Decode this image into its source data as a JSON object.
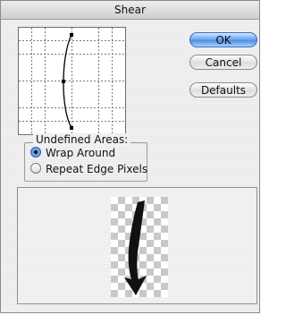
{
  "window": {
    "title": "Shear"
  },
  "buttons": {
    "ok": "OK",
    "cancel": "Cancel",
    "defaults": "Defaults"
  },
  "undefined_areas": {
    "label": "Undefined Areas:",
    "options": [
      {
        "label": "Wrap Around",
        "selected": true
      },
      {
        "label": "Repeat Edge Pixels",
        "selected": false
      }
    ]
  },
  "colors": {
    "accent": "#4d8fe6",
    "curve": "#000000"
  }
}
